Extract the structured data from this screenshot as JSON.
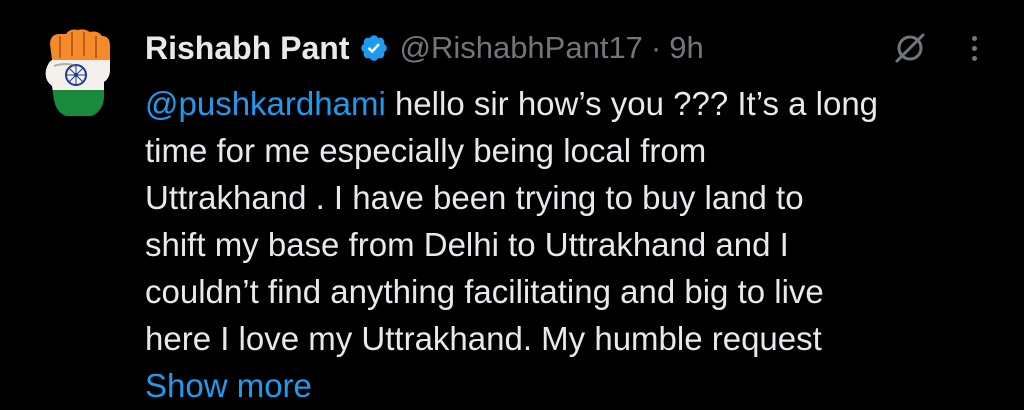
{
  "post": {
    "author_name": "Rishabh Pant",
    "handle": "@RishabhPant17",
    "separator": "·",
    "time": "9h",
    "mention": "@pushkardhami",
    "line1_rest": " hello sir how’s you ???  It’s a long",
    "lines": [
      "time for me especially being local from",
      "Uttrakhand . I have been trying to buy land to",
      "shift my base from Delhi to Uttrakhand and I",
      "couldn’t find anything facilitating and big to live",
      "here I love my Uttrakhand. My humble request"
    ],
    "show_more": "Show more"
  },
  "icons": {
    "avatar": "fist-indian-flag-avatar",
    "verified": "verified-badge-icon",
    "grok": "grok-icon",
    "more": "more-vertical-icon"
  },
  "colors": {
    "background": "#000000",
    "text": "#e7e9ea",
    "secondary": "#71767b",
    "link": "#1d9bf0",
    "saffron": "#f58a2a",
    "green": "#1a8a3c"
  }
}
